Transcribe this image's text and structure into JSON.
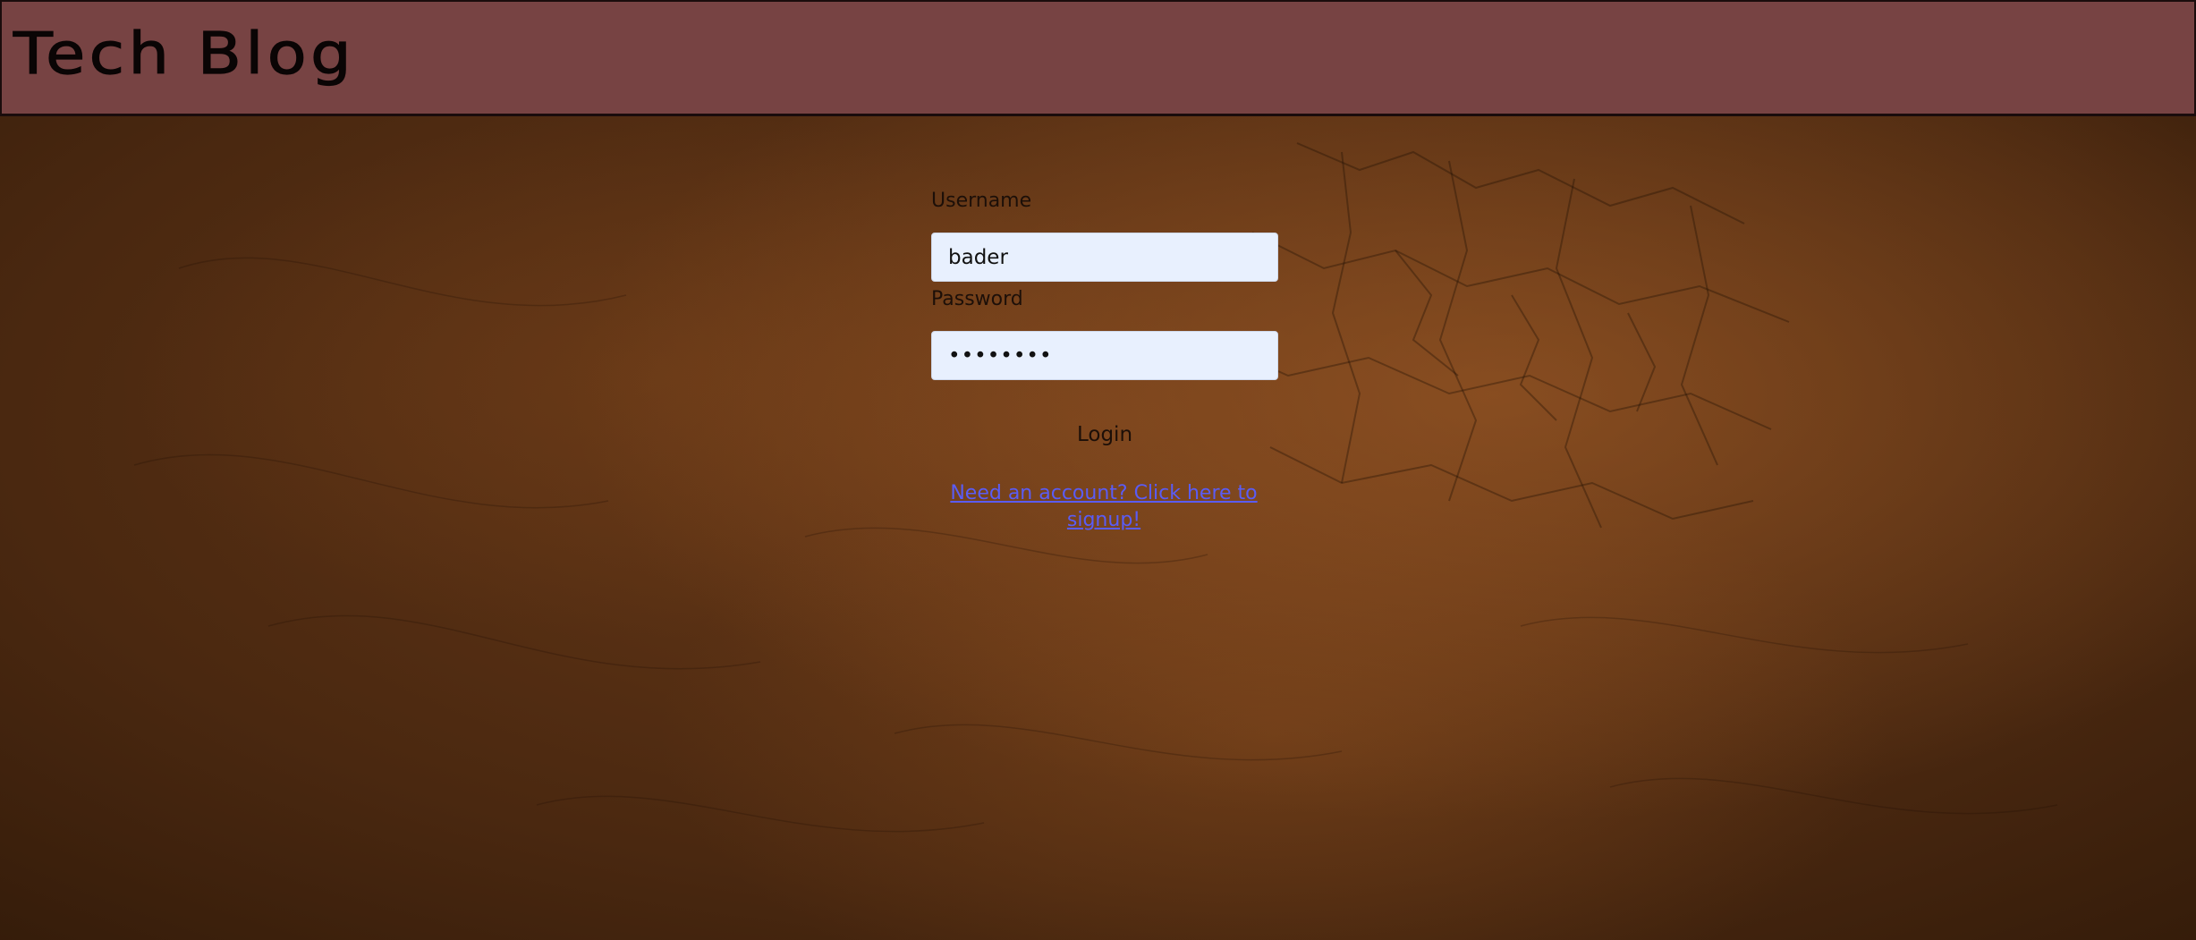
{
  "header": {
    "title": "Tech Blog",
    "background_color": "#774343"
  },
  "login": {
    "username_label": "Username",
    "username_value": "bader",
    "password_label": "Password",
    "password_value": "••••••••",
    "login_button": "Login",
    "signup_link": "Need an account? Click here to signup!"
  },
  "theme": {
    "background_style": "brown leather texture",
    "input_background": "#e8f0fe",
    "link_color": "#5a5cf5"
  }
}
